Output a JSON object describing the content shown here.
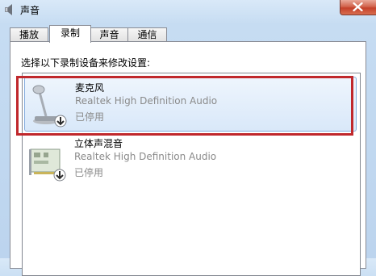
{
  "window": {
    "title": "声音",
    "close_icon": "close-icon",
    "app_icon": "speaker-icon"
  },
  "tabs": [
    {
      "label": "播放",
      "active": false
    },
    {
      "label": "录制",
      "active": true
    },
    {
      "label": "声音",
      "active": false
    },
    {
      "label": "通信",
      "active": false
    }
  ],
  "recording": {
    "instruction": "选择以下录制设备来修改设置:",
    "devices": [
      {
        "name": "麦克风",
        "driver": "Realtek High Definition Audio",
        "status": "已停用",
        "icon": "microphone-icon",
        "badge_icon": "disabled-down-arrow-icon",
        "selected": true
      },
      {
        "name": "立体声混音",
        "driver": "Realtek High Definition Audio",
        "status": "已停用",
        "icon": "sound-card-icon",
        "badge_icon": "disabled-down-arrow-icon",
        "selected": false
      }
    ]
  },
  "colors": {
    "highlight_border": "#c0282c",
    "selection_border": "#84acdd",
    "disabled_text": "#8a8a8a"
  }
}
